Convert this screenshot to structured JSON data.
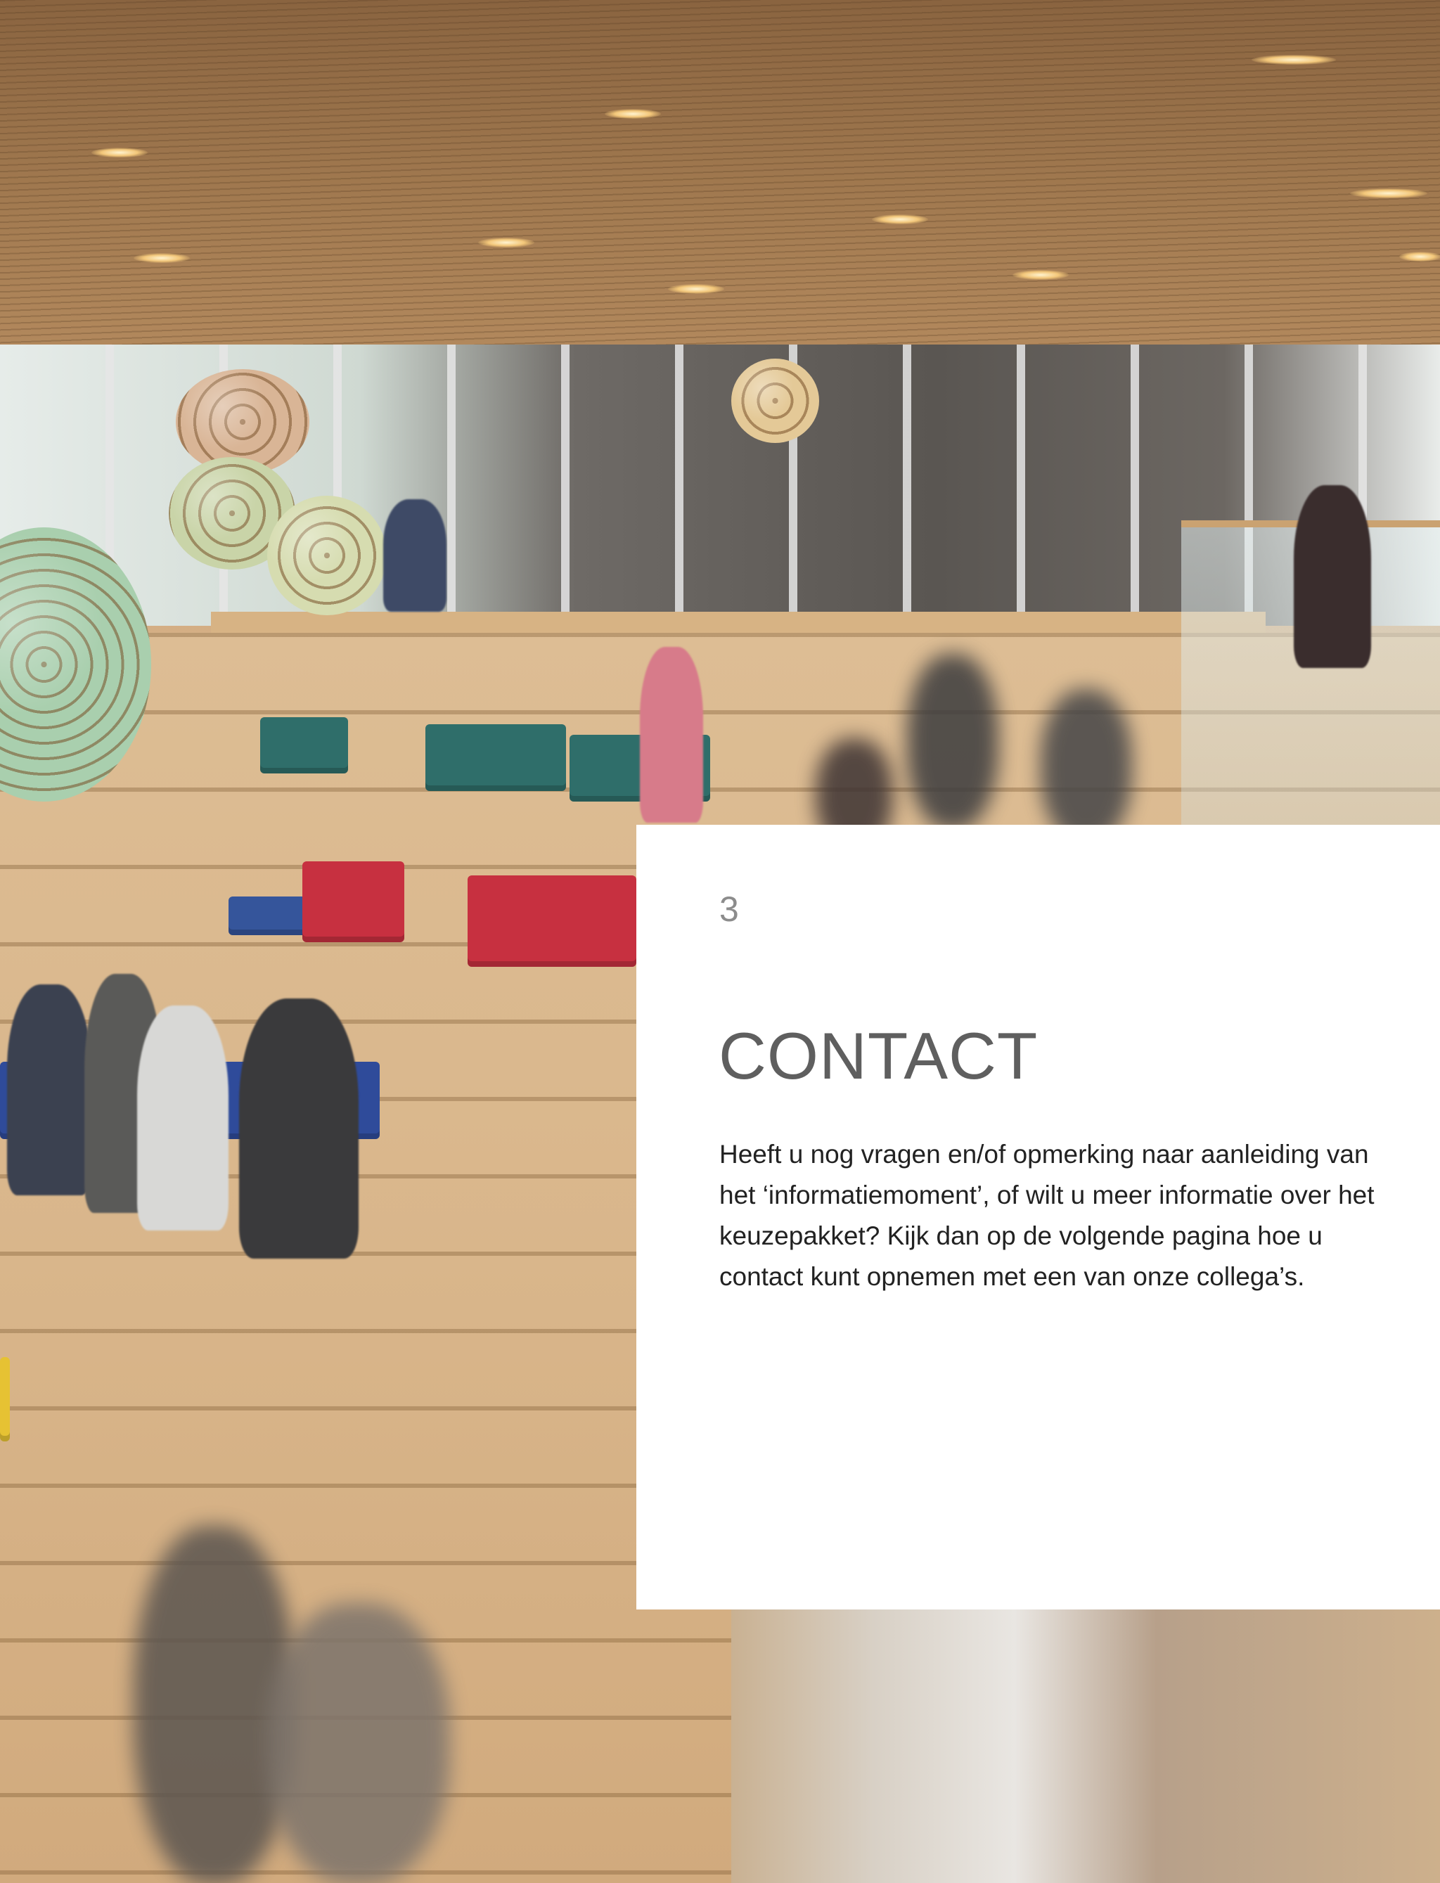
{
  "page": {
    "number": "3",
    "title": "CONTACT",
    "body": "Heeft u nog vragen en/of opmerking naar aanleiding van het ‘informatiemoment’, of wilt u meer informatie over het keuzepakket? Kijk dan op de volgende pagina hoe u contact kunt opnemen met een van onze collega’s."
  },
  "colors": {
    "card_background": "#ffffff",
    "title_color": "#5f5f5f",
    "page_number_color": "#8c8c8c",
    "body_color": "#222222"
  },
  "background_photo": {
    "icon": "school-atrium-photo"
  }
}
